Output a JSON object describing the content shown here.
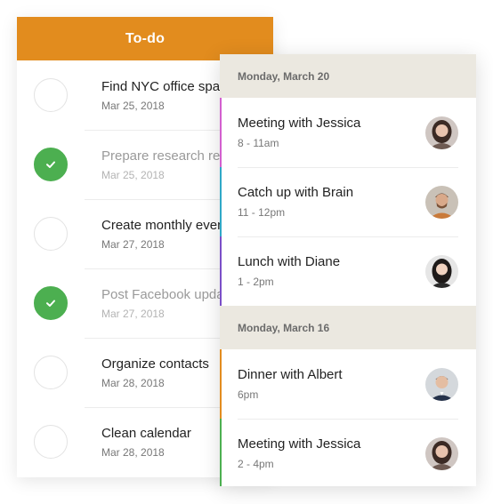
{
  "todo": {
    "title": "To-do",
    "accent": "#e28c1e",
    "done_color": "#4caf50",
    "items": [
      {
        "title": "Find NYC office space",
        "date": "Mar 25, 2018",
        "done": false
      },
      {
        "title": "Prepare research report",
        "date": "Mar 25, 2018",
        "done": true
      },
      {
        "title": "Create monthly event",
        "date": "Mar 27, 2018",
        "done": false
      },
      {
        "title": "Post Facebook update",
        "date": "Mar 27, 2018",
        "done": true
      },
      {
        "title": "Organize contacts",
        "date": "Mar 28, 2018",
        "done": false
      },
      {
        "title": "Clean calendar",
        "date": "Mar 28, 2018",
        "done": false
      }
    ]
  },
  "calendar": {
    "days": [
      {
        "label": "Monday, March 20",
        "events": [
          {
            "title": "Meeting with Jessica",
            "time": "8 - 11am",
            "color": "#d35fcf"
          },
          {
            "title": "Catch up with Brain",
            "time": "11 - 12pm",
            "color": "#2fa8c7"
          },
          {
            "title": "Lunch with Diane",
            "time": "1 - 2pm",
            "color": "#7a4fc8"
          }
        ]
      },
      {
        "label": "Monday, March 16",
        "events": [
          {
            "title": "Dinner with Albert",
            "time": "6pm",
            "color": "#e28c1e"
          },
          {
            "title": "Meeting with Jessica",
            "time": "2 - 4pm",
            "color": "#4caf50"
          }
        ]
      }
    ]
  }
}
